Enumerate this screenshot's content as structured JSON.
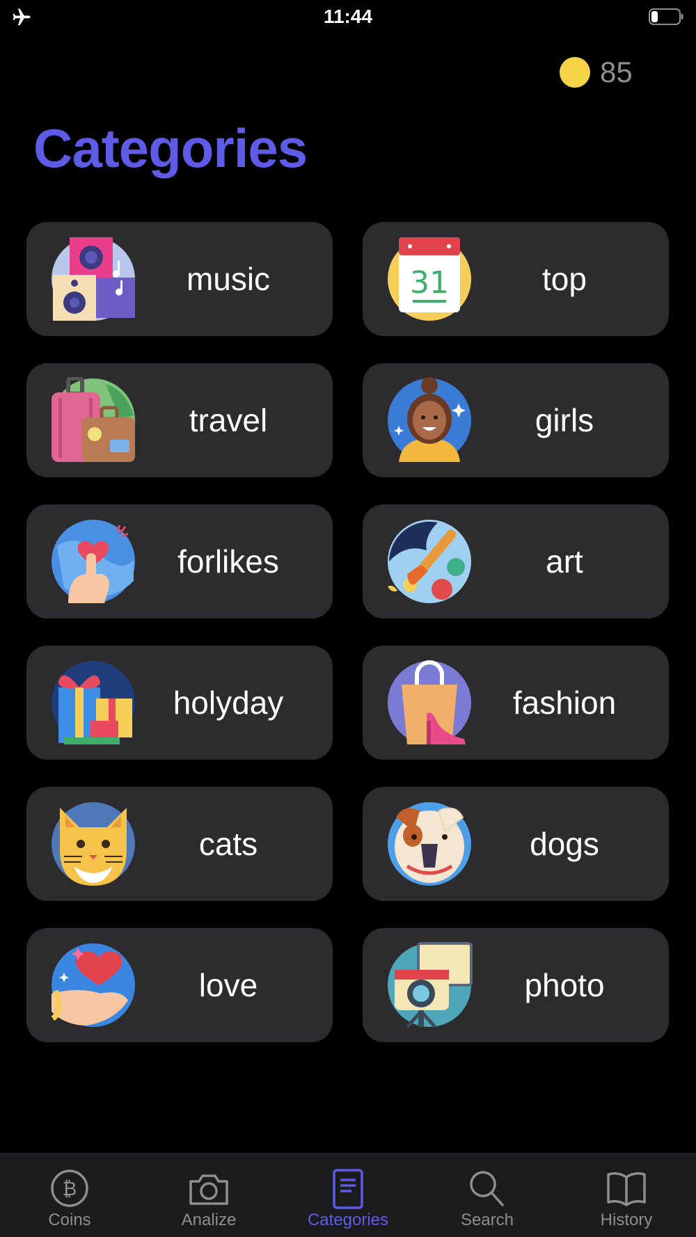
{
  "status_bar": {
    "time": "11:44"
  },
  "header": {
    "coin_count": "85",
    "title": "Categories"
  },
  "categories": [
    {
      "label": "music",
      "icon": "music-speakers-icon"
    },
    {
      "label": "top",
      "icon": "calendar-31-icon"
    },
    {
      "label": "travel",
      "icon": "suitcase-icon"
    },
    {
      "label": "girls",
      "icon": "girl-avatar-icon"
    },
    {
      "label": "forlikes",
      "icon": "finger-heart-icon"
    },
    {
      "label": "art",
      "icon": "paint-palette-icon"
    },
    {
      "label": "holyday",
      "icon": "gift-box-icon"
    },
    {
      "label": "fashion",
      "icon": "shopping-bag-heel-icon"
    },
    {
      "label": "cats",
      "icon": "cat-face-icon"
    },
    {
      "label": "dogs",
      "icon": "bulldog-face-icon"
    },
    {
      "label": "love",
      "icon": "hand-heart-icon"
    },
    {
      "label": "photo",
      "icon": "camera-icon"
    }
  ],
  "tab_bar": {
    "tabs": [
      {
        "label": "Coins",
        "icon": "bitcoin-icon"
      },
      {
        "label": "Analize",
        "icon": "camera-icon"
      },
      {
        "label": "Categories",
        "icon": "document-icon",
        "active": true
      },
      {
        "label": "Search",
        "icon": "magnifier-icon"
      },
      {
        "label": "History",
        "icon": "book-icon"
      }
    ]
  },
  "colors": {
    "accent": "#5e5ce6",
    "background": "#000000",
    "card": "#2c2c2e",
    "tab_bar": "#1c1c1e",
    "inactive": "#8e8e93",
    "coin": "#f5d547"
  }
}
